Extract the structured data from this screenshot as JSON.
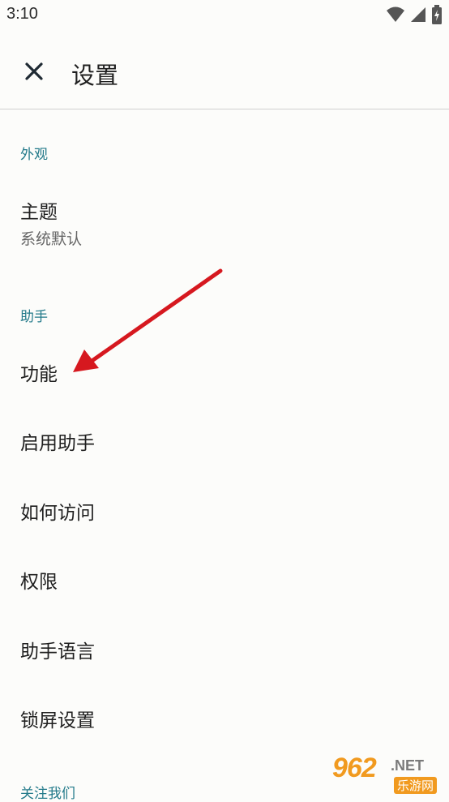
{
  "status_bar": {
    "time": "3:10"
  },
  "app_bar": {
    "title": "设置"
  },
  "sections": [
    {
      "header": "外观"
    },
    {
      "header": "助手"
    },
    {
      "header": "关注我们"
    }
  ],
  "items": {
    "theme": {
      "title": "主题",
      "subtitle": "系统默认"
    },
    "features": {
      "title": "功能"
    },
    "enable_assistant": {
      "title": "启用助手"
    },
    "how_to_access": {
      "title": "如何访问"
    },
    "permissions": {
      "title": "权限"
    },
    "assistant_language": {
      "title": "助手语言"
    },
    "lock_screen_settings": {
      "title": "锁屏设置"
    }
  },
  "watermark": {
    "number": "962",
    "suffix": ".NET",
    "cn": "乐游网"
  },
  "colors": {
    "accent": "#237a8a",
    "annotation_arrow": "#d6181f",
    "background": "#fcfcfa"
  },
  "icons": [
    "close-icon",
    "wifi-icon",
    "cell-signal-icon",
    "battery-icon"
  ]
}
